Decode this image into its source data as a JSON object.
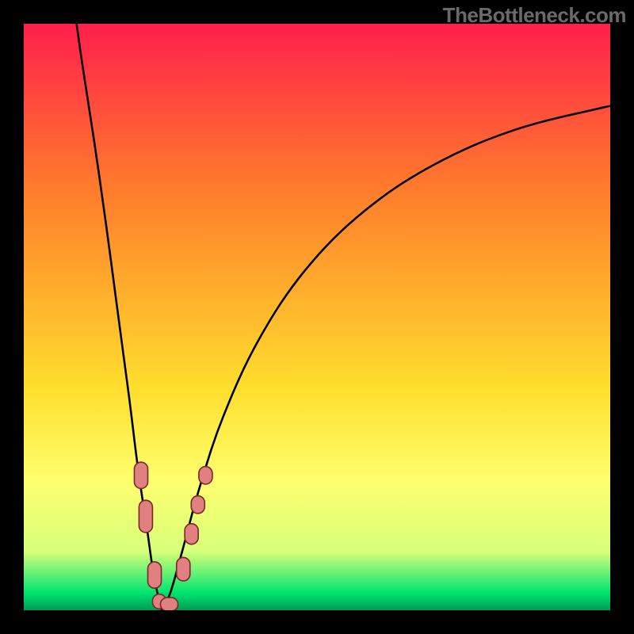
{
  "watermark": "TheBottleneck.com",
  "chart_data": {
    "type": "line",
    "title": "",
    "xlabel": "",
    "ylabel": "",
    "xlim": [
      0,
      100
    ],
    "ylim": [
      0,
      100
    ],
    "background_gradient": {
      "top": "#ff1f4c",
      "upper_mid": "#ff7b2c",
      "mid": "#ffde2d",
      "lower_mid": "#ffff6e",
      "lower": "#d7ff7a",
      "bottom": "#00e56f",
      "base": "#009a55"
    },
    "series": [
      {
        "name": "left-branch",
        "x": [
          9,
          10,
          12,
          14,
          16,
          18,
          19.5,
          21,
          22,
          23,
          23.6
        ],
        "y": [
          100,
          93,
          80,
          66,
          51,
          36,
          24,
          14,
          7,
          2,
          0
        ]
      },
      {
        "name": "right-branch",
        "x": [
          23.6,
          25,
          27,
          30,
          34,
          40,
          48,
          58,
          70,
          84,
          100
        ],
        "y": [
          0,
          3,
          10,
          21,
          33,
          46,
          58,
          68,
          76,
          82,
          86
        ]
      }
    ],
    "markers": {
      "color": "#e08080",
      "outline": "#7a2a2a",
      "points": [
        {
          "x": 20.0,
          "y": 23,
          "w": 2.3,
          "h": 4.5
        },
        {
          "x": 20.8,
          "y": 16,
          "w": 2.3,
          "h": 5.5
        },
        {
          "x": 22.3,
          "y": 6,
          "w": 2.3,
          "h": 4.5
        },
        {
          "x": 23.1,
          "y": 1.5,
          "w": 2.3,
          "h": 2.5
        },
        {
          "x": 24.8,
          "y": 1.0,
          "w": 3.0,
          "h": 2.3
        },
        {
          "x": 27.2,
          "y": 7,
          "w": 2.3,
          "h": 4.0
        },
        {
          "x": 28.6,
          "y": 13,
          "w": 2.3,
          "h": 3.5
        },
        {
          "x": 29.7,
          "y": 18,
          "w": 2.3,
          "h": 3.0
        },
        {
          "x": 31.0,
          "y": 23,
          "w": 2.3,
          "h": 3.0
        }
      ]
    }
  }
}
